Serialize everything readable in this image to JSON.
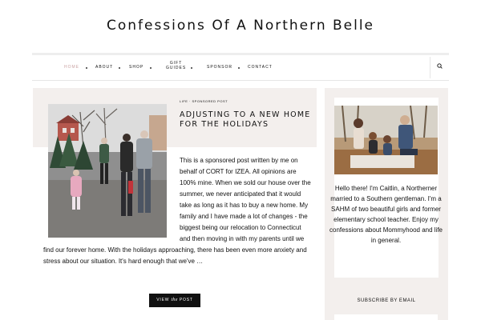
{
  "site": {
    "title": "Confessions Of A Northern Belle"
  },
  "nav": {
    "items": [
      "HOME",
      "ABOUT",
      "SHOP",
      "SPONSOR",
      "CONTACT"
    ],
    "gift_guides_line1": "GIFT",
    "gift_guides_line2": "GUIDES",
    "search_icon": "search-icon"
  },
  "post": {
    "categories": "LIFE · SPONSORED POST",
    "title": "ADJUSTING TO A NEW HOME FOR THE HOLIDAYS",
    "excerpt": "This is a sponsored post written by me on behalf of CORT for IZEA. All opinions are 100% mine. When we sold our house over the summer, we never anticipated that it would take as long as it has to buy a new home. My family and I have made a lot of changes - the biggest being our relocation to Connecticut and then moving in with my parents until we find our forever home. With the holidays approaching, there has been even more anxiety and stress about our situation. It's hard enough that we've …",
    "button_pre": "VIEW ",
    "button_italic": "the",
    "button_post": " POST"
  },
  "sidebar": {
    "bio": "Hello there! I'm Caitlin, a Northerner married to a Southern gentleman. I'm a SAHM of two beautiful girls and former elementary school teacher. Enjoy my confessions about Mommyhood and life in general.",
    "subscribe_title": "SUBSCRIBE BY EMAIL"
  },
  "colors": {
    "accent": "#c9a2a2",
    "panel": "#f3efed",
    "button": "#111111"
  }
}
